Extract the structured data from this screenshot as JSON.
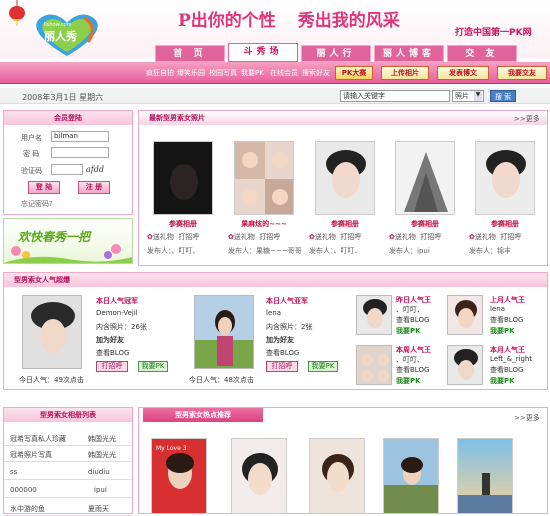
{
  "header": {
    "logo_text": "丽人秀",
    "logo_url_text": "lishow.com",
    "slogan_part1": "P出你的个性",
    "slogan_part2": "秀出我的风采",
    "pk_slogan": "打造中国第一PK网"
  },
  "nav": {
    "tabs": [
      {
        "label": "首 页"
      },
      {
        "label": "斗秀场"
      },
      {
        "label": "丽人行"
      },
      {
        "label": "丽人博客"
      },
      {
        "label": "交 友"
      }
    ]
  },
  "subnav": {
    "links": [
      "疯狂自拍",
      "爆笑乐园",
      "校园写真",
      "我要PK",
      "在线会员",
      "搜索好友"
    ],
    "pk_button": "PK大赛",
    "upload_button": "上传相片",
    "blog_button": "发表博文",
    "friend_button": "我要交友"
  },
  "datebar": {
    "date": "2008年3月1日  星期六",
    "search_placeholder": "请输入关键字",
    "search_option": "照片",
    "search_button": "搜 索"
  },
  "login": {
    "title": "会员登陆",
    "username_label": "用户名",
    "username_value": "bilman",
    "password_label": "密  码",
    "captcha_label": "验证码",
    "captcha_text": "afdd",
    "login_button": "登 陆",
    "register_button": "注 册",
    "forgot": "忘记密码?"
  },
  "banner": {
    "text": "欢快春秀一把"
  },
  "new_photos": {
    "title": "最新型男索女照片",
    "more": ">>更多",
    "items": [
      {
        "caption": "参赛相册",
        "gift": "送礼物",
        "greet": "打招呼",
        "publisher": "发布人：、叮叮、"
      },
      {
        "caption": "果麻炫的~~~",
        "gift": "送礼物",
        "greet": "打招呼",
        "publisher": "发布人：果糖~~~哥哥"
      },
      {
        "caption": "参赛相册",
        "gift": "送礼物",
        "greet": "打招呼",
        "publisher": "发布人：、叮叮、"
      },
      {
        "caption": "参赛相册",
        "gift": "送礼物",
        "greet": "打招呼",
        "publisher": "发布人：ipui"
      },
      {
        "caption": "参赛相册",
        "gift": "送礼物",
        "greet": "打招呼",
        "publisher": "发布人：锦丰"
      }
    ]
  },
  "popularity": {
    "title": "型男索女人气超爆",
    "champion_m": {
      "title": "本日人气冠军",
      "name": "Demon-Vejil",
      "photos": "内含照片：26张",
      "add_friend": "加为好友",
      "view_blog": "查看BLOG",
      "greet": "打招呼",
      "pk": "我要PK",
      "today": "今日人气：49次点击"
    },
    "champion_f": {
      "title": "本日人气亚军",
      "name": "lena",
      "photos": "内含照片：2张",
      "add_friend": "加为好友",
      "view_blog": "查看BLOG",
      "greet": "打招呼",
      "pk": "我要PK",
      "today": "今日人气：48次点击"
    },
    "kings": [
      {
        "title": "昨日人气王",
        "name": "、叮叮、",
        "blog": "查看BLOG",
        "pk": "我要PK"
      },
      {
        "title": "上月人气王",
        "name": "lena",
        "blog": "查看BLOG",
        "pk": "我要PK"
      },
      {
        "title": "本周人气王",
        "name": "、叮叮、",
        "blog": "查看BLOG",
        "pk": "我要PK"
      },
      {
        "title": "本月人气王",
        "name": "Left_&_right",
        "blog": "查看BLOG",
        "pk": "我要PK"
      }
    ]
  },
  "rank": {
    "title": "型男索女相册列表",
    "rows": [
      {
        "a": "冠希写真私人珍藏",
        "b": "韩国光光"
      },
      {
        "a": "冠希照片写真",
        "b": "韩国光光"
      },
      {
        "a": "ss",
        "b": "diudiu"
      },
      {
        "a": "000000",
        "b": "ipui"
      },
      {
        "a": "水中游的鱼",
        "b": "夏雨天"
      }
    ]
  },
  "hot": {
    "title": "型男索女热点推荐",
    "more": ">>更多",
    "first_photo_text": "My Love 3"
  }
}
